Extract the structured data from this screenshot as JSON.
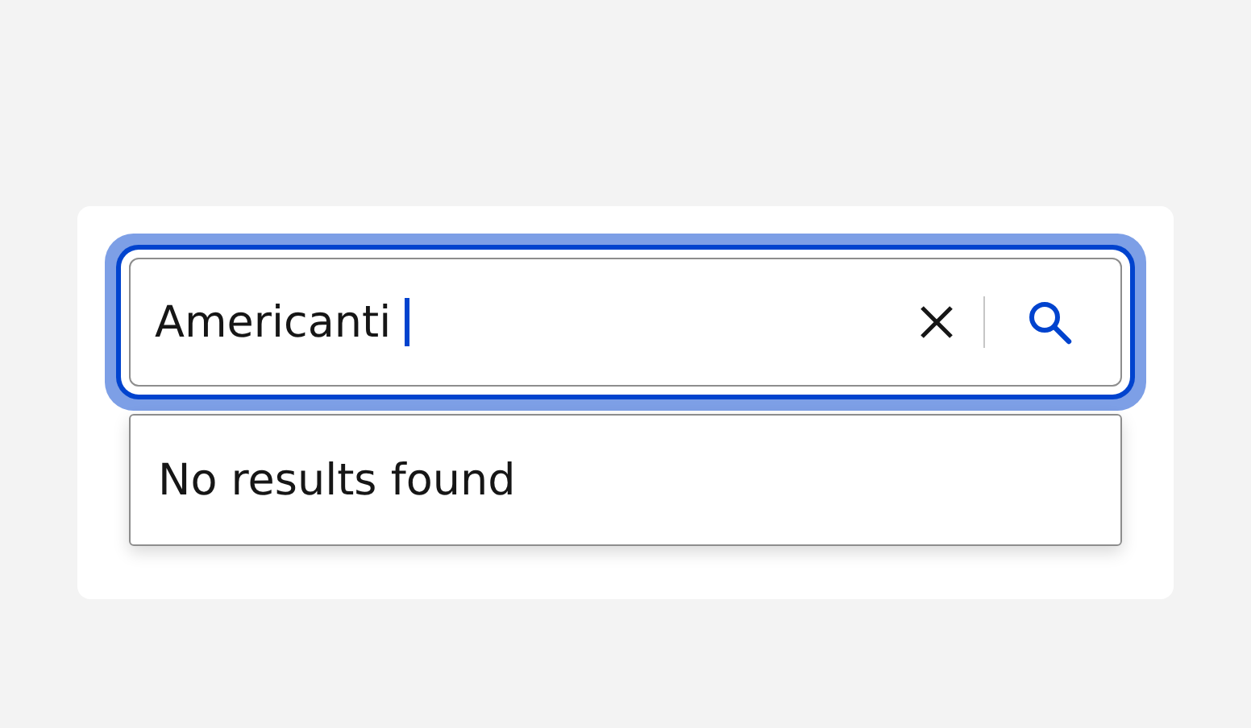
{
  "search": {
    "value": "Americanti",
    "focused": true
  },
  "dropdown": {
    "message": "No results found"
  }
}
